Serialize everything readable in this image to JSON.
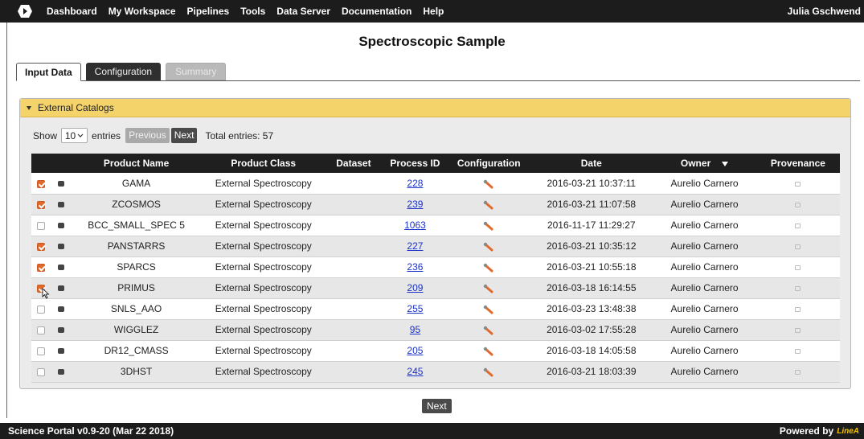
{
  "nav": {
    "items": [
      "Dashboard",
      "My Workspace",
      "Pipelines",
      "Tools",
      "Data Server",
      "Documentation",
      "Help"
    ],
    "user": "Julia Gschwend"
  },
  "page": {
    "title": "Spectroscopic Sample"
  },
  "tabs": [
    {
      "label": "Input Data",
      "state": "active"
    },
    {
      "label": "Configuration",
      "state": "normal"
    },
    {
      "label": "Summary",
      "state": "disabled"
    }
  ],
  "panel": {
    "title": "External Catalogs",
    "show_label": "Show",
    "entries_value": "10",
    "entries_label": "entries",
    "previous_label": "Previous",
    "next_label": "Next",
    "total_label": "Total entries: 57"
  },
  "table": {
    "headers": [
      "Product Name",
      "Product Class",
      "Dataset",
      "Process ID",
      "Configuration",
      "Date",
      "Owner",
      "Provenance"
    ],
    "rows": [
      {
        "checked": true,
        "name": "GAMA",
        "class": "External Spectroscopy",
        "dataset": "",
        "pid": "228",
        "date": "2016-03-21 10:37:11",
        "owner": "Aurelio Carnero"
      },
      {
        "checked": true,
        "name": "ZCOSMOS",
        "class": "External Spectroscopy",
        "dataset": "",
        "pid": "239",
        "date": "2016-03-21 11:07:58",
        "owner": "Aurelio Carnero"
      },
      {
        "checked": false,
        "name": "BCC_SMALL_SPEC 5",
        "class": "External Spectroscopy",
        "dataset": "",
        "pid": "1063",
        "date": "2016-11-17 11:29:27",
        "owner": "Aurelio Carnero"
      },
      {
        "checked": true,
        "name": "PANSTARRS",
        "class": "External Spectroscopy",
        "dataset": "",
        "pid": "227",
        "date": "2016-03-21 10:35:12",
        "owner": "Aurelio Carnero"
      },
      {
        "checked": true,
        "name": "SPARCS",
        "class": "External Spectroscopy",
        "dataset": "",
        "pid": "236",
        "date": "2016-03-21 10:55:18",
        "owner": "Aurelio Carnero"
      },
      {
        "checked": true,
        "name": "PRIMUS",
        "class": "External Spectroscopy",
        "dataset": "",
        "pid": "209",
        "date": "2016-03-18 16:14:55",
        "owner": "Aurelio Carnero"
      },
      {
        "checked": false,
        "name": "SNLS_AAO",
        "class": "External Spectroscopy",
        "dataset": "",
        "pid": "255",
        "date": "2016-03-23 13:48:38",
        "owner": "Aurelio Carnero"
      },
      {
        "checked": false,
        "name": "WIGGLEZ",
        "class": "External Spectroscopy",
        "dataset": "",
        "pid": "95",
        "date": "2016-03-02 17:55:28",
        "owner": "Aurelio Carnero"
      },
      {
        "checked": false,
        "name": "DR12_CMASS",
        "class": "External Spectroscopy",
        "dataset": "",
        "pid": "205",
        "date": "2016-03-18 14:05:58",
        "owner": "Aurelio Carnero"
      },
      {
        "checked": false,
        "name": "3DHST",
        "class": "External Spectroscopy",
        "dataset": "",
        "pid": "245",
        "date": "2016-03-21 18:03:39",
        "owner": "Aurelio Carnero"
      }
    ]
  },
  "bottom": {
    "next_label": "Next"
  },
  "footer": {
    "version": "Science Portal v0.9-20 (Mar 22 2018)",
    "powered": "Powered by",
    "brand": "LineA"
  },
  "colors": {
    "accent": "#e06a2c",
    "panel_header": "#f4d36b",
    "link": "#1a33c8",
    "bar": "#1c1c1c"
  }
}
